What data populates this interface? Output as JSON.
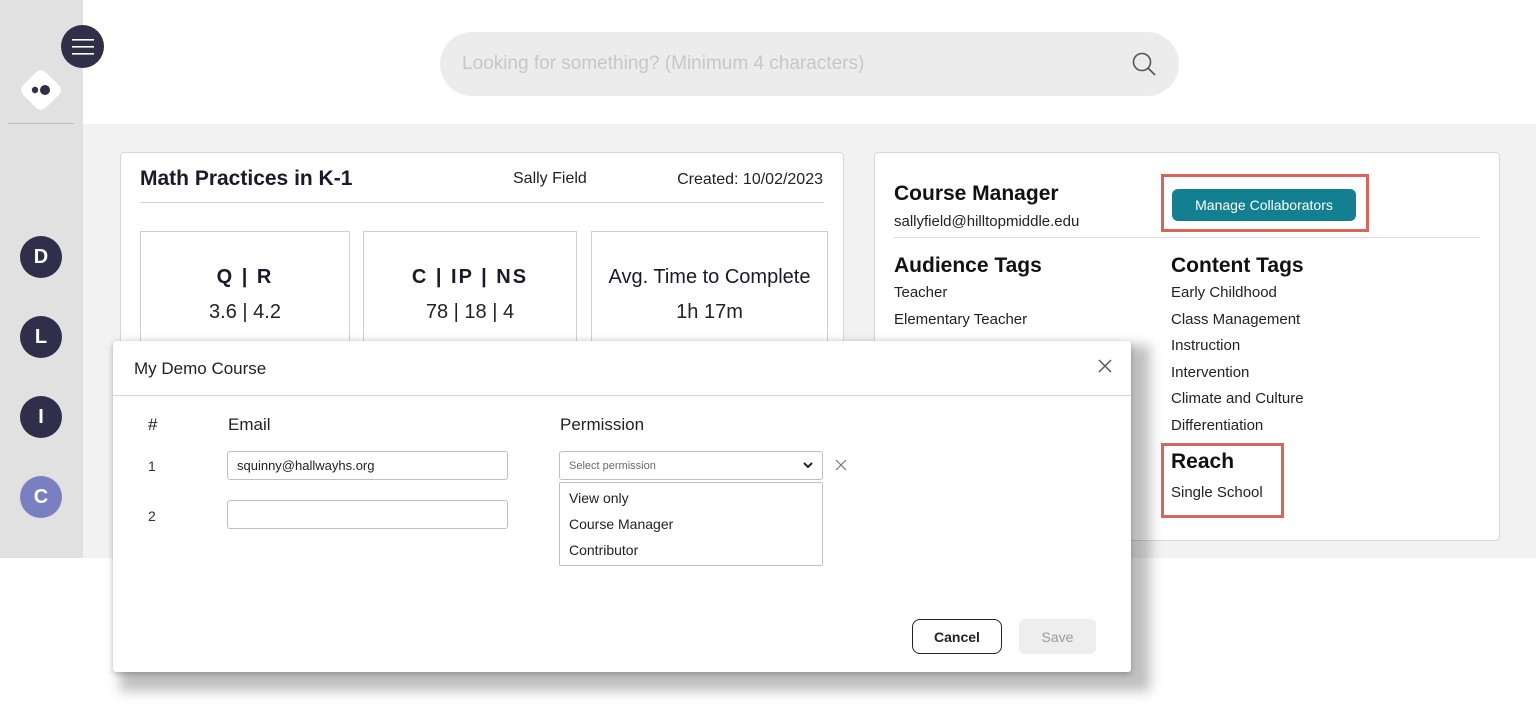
{
  "search": {
    "placeholder": "Looking for something? (Minimum 4 characters)"
  },
  "rail": {
    "items": [
      {
        "label": "D"
      },
      {
        "label": "L"
      },
      {
        "label": "I"
      },
      {
        "label": "C"
      }
    ]
  },
  "course": {
    "title": "Math Practices in K-1",
    "author": "Sally Field",
    "created": "Created: 10/02/2023",
    "stats": [
      {
        "label": "Q | R",
        "value": "3.6 | 4.2"
      },
      {
        "label": "C | IP | NS",
        "value": "78 | 18 | 4"
      },
      {
        "label": "Avg. Time to Complete",
        "value": "1h 17m"
      }
    ]
  },
  "panel": {
    "manager_heading": "Course Manager",
    "manager_email": "sallyfield@hilltopmiddle.edu",
    "manage_button": "Manage Collaborators",
    "audience_heading": "Audience Tags",
    "audience_tags": [
      "Teacher",
      "Elementary Teacher"
    ],
    "content_heading": "Content Tags",
    "content_tags": [
      "Early Childhood",
      "Class Management",
      "Instruction",
      "Intervention",
      "Climate and Culture",
      "Differentiation"
    ],
    "reach_heading": "Reach",
    "reach_value": "Single School"
  },
  "modal": {
    "title": "My Demo Course",
    "col_num": "#",
    "col_email": "Email",
    "col_permission": "Permission",
    "rows": [
      {
        "num": "1",
        "email": "squinny@hallwayhs.org"
      },
      {
        "num": "2",
        "email": ""
      }
    ],
    "select_placeholder": "Select permission",
    "options": [
      "View only",
      "Course Manager",
      "Contributor"
    ],
    "cancel": "Cancel",
    "save": "Save"
  },
  "colors": {
    "accent": "#128090",
    "highlight": "#d9655a",
    "rail_dark": "#2f2f4a",
    "rail_active": "#7a7fc1"
  }
}
